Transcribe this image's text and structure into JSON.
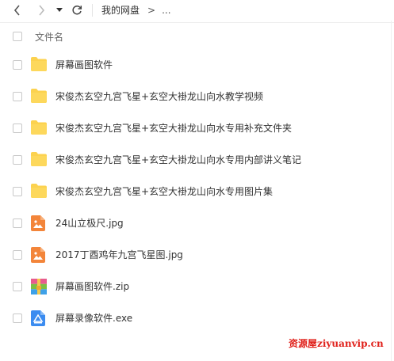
{
  "toolbar": {
    "back_icon": "chevron-left-icon",
    "forward_icon": "chevron-right-icon",
    "dropdown_icon": "caret-down-icon",
    "refresh_icon": "refresh-icon"
  },
  "breadcrumb": {
    "root": "我的网盘",
    "separator": ">",
    "more": "..."
  },
  "table": {
    "column_name": "文件名"
  },
  "files": [
    {
      "name": "屏幕画图软件",
      "type": "folder"
    },
    {
      "name": "宋俊杰玄空九宫飞星+玄空大褂龙山向水教学视频",
      "type": "folder"
    },
    {
      "name": "宋俊杰玄空九宫飞星+玄空大褂龙山向水专用补充文件夹",
      "type": "folder"
    },
    {
      "name": "宋俊杰玄空九宫飞星+玄空大褂龙山向水专用内部讲义笔记",
      "type": "folder"
    },
    {
      "name": "宋俊杰玄空九宫飞星+玄空大褂龙山向水专用图片集",
      "type": "folder"
    },
    {
      "name": "24山立极尺.jpg",
      "type": "image"
    },
    {
      "name": "2017丁酉鸡年九宫飞星图.jpg",
      "type": "image"
    },
    {
      "name": "屏幕画图软件.zip",
      "type": "zip"
    },
    {
      "name": "屏幕录像软件.exe",
      "type": "exe"
    }
  ],
  "watermark": "资源屋ziyuanvip.cn",
  "colors": {
    "folder": "#fcd24f",
    "image": "#f3853a",
    "exe": "#3b8cf0",
    "watermark": "#e0211b"
  }
}
